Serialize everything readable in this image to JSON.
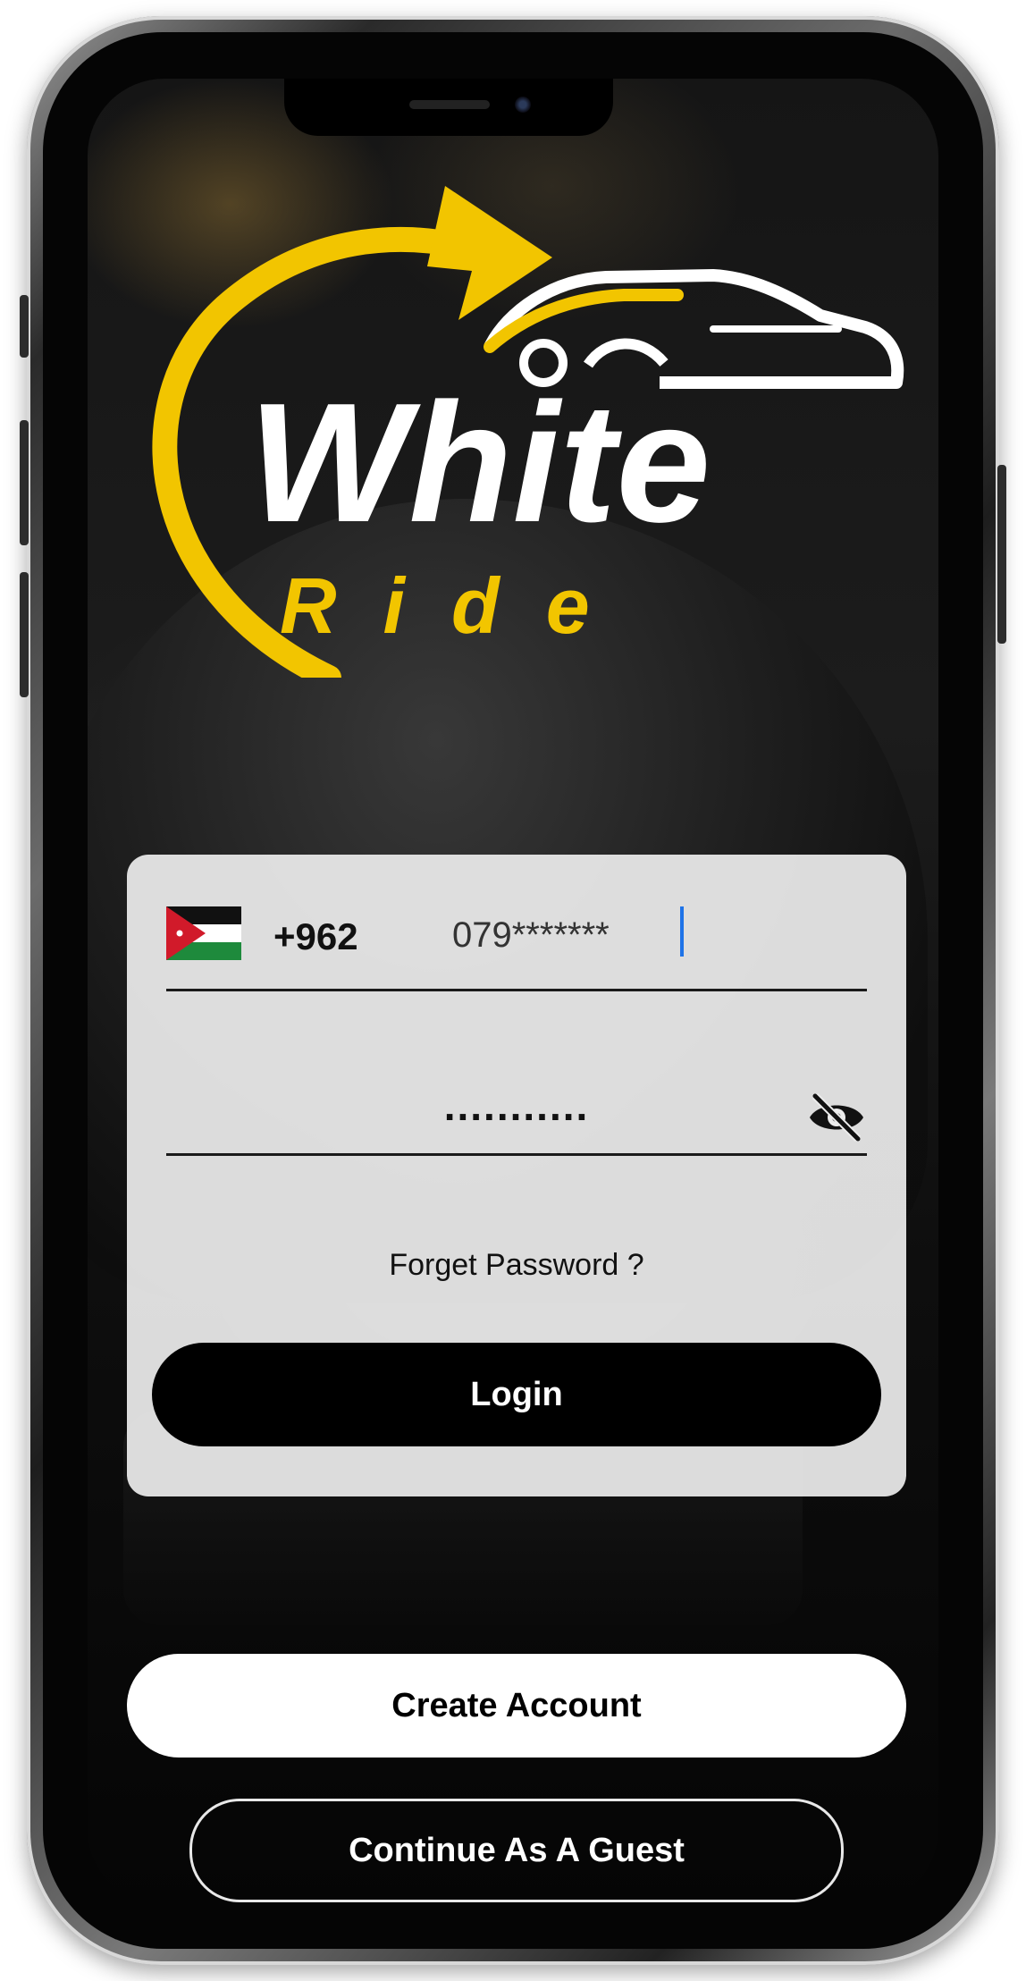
{
  "brand": {
    "logo_word": "White",
    "logo_subword": "Ride",
    "accent_color": "#f2c500",
    "logo_text_color": "#ffffff"
  },
  "login_form": {
    "country_flag_icon": "jordan-flag-icon",
    "dial_code": "+962",
    "phone_value": "079*******",
    "password_value": "...........",
    "password_toggle_icon": "eye-slash-icon",
    "forgot_password_label": "Forget Password ?",
    "login_label": "Login"
  },
  "actions": {
    "create_account_label": "Create Account",
    "guest_label": "Continue As A Guest"
  },
  "colors": {
    "card_background": "#ececec",
    "primary_button": "#000000",
    "secondary_button": "#ffffff",
    "caret": "#1e73e8"
  }
}
